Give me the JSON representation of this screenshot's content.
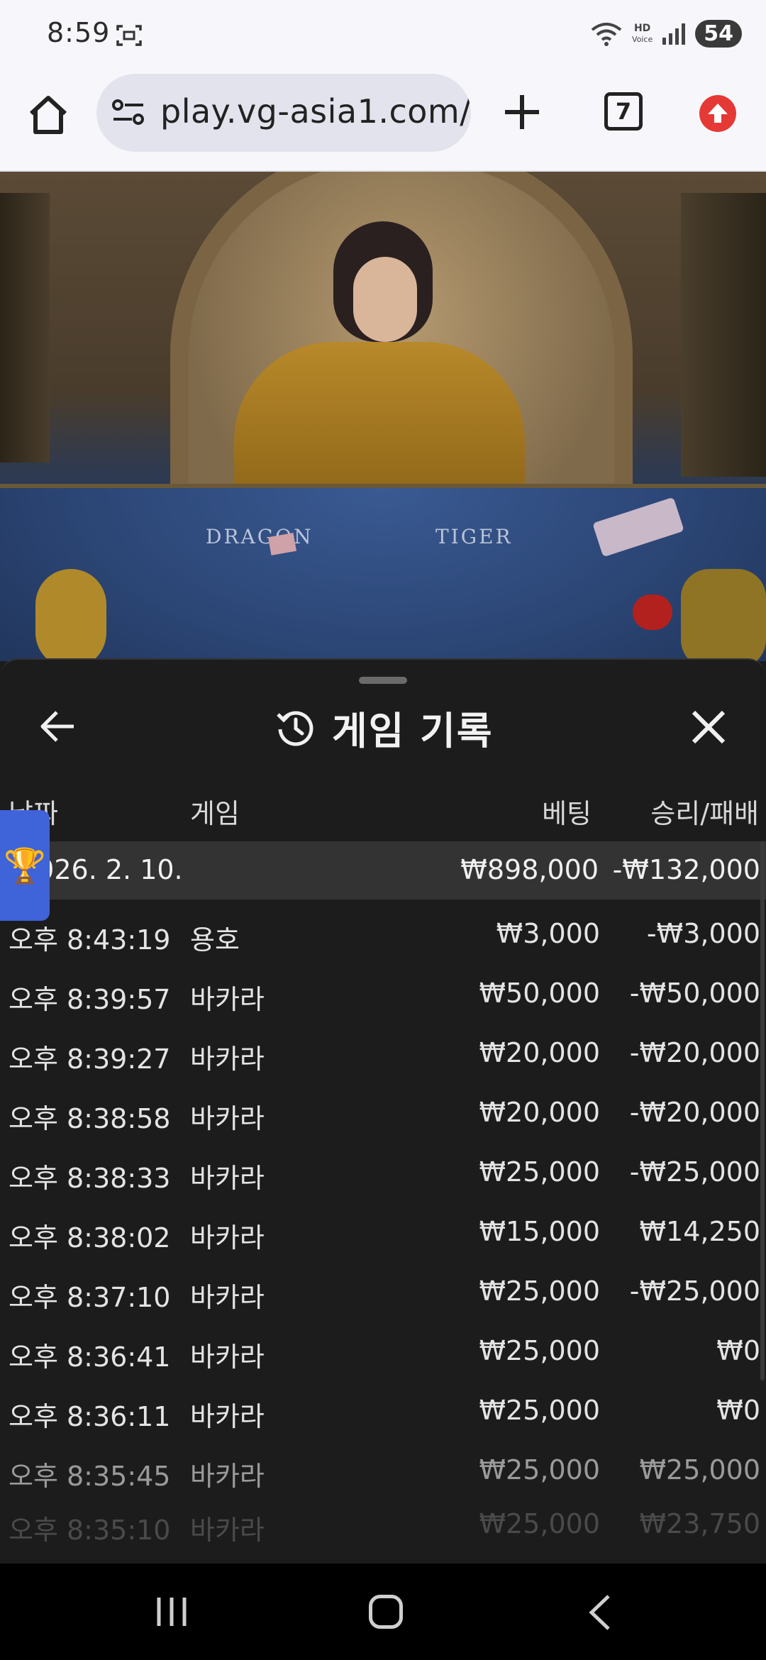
{
  "status": {
    "time": "8:59",
    "hd_line1": "HD",
    "hd_line2": "Voice",
    "battery": "54"
  },
  "browser": {
    "url": "play.vg-asia1.com/",
    "tab_count": "7"
  },
  "video": {
    "label_left": "DRAGON",
    "label_right": "TIGER"
  },
  "panel": {
    "title": "게임 기록",
    "headers": {
      "date": "날짜",
      "game": "게임",
      "bet": "베팅",
      "result": "승리/패배"
    },
    "summary": {
      "date": "2026. 2. 10.",
      "bet": "₩898,000",
      "result": "-₩132,000"
    },
    "rows": [
      {
        "time": "오후 8:43:19",
        "game": "용호",
        "bet": "₩3,000",
        "result": "-₩3,000"
      },
      {
        "time": "오후 8:39:57",
        "game": "바카라",
        "bet": "₩50,000",
        "result": "-₩50,000"
      },
      {
        "time": "오후 8:39:27",
        "game": "바카라",
        "bet": "₩20,000",
        "result": "-₩20,000"
      },
      {
        "time": "오후 8:38:58",
        "game": "바카라",
        "bet": "₩20,000",
        "result": "-₩20,000"
      },
      {
        "time": "오후 8:38:33",
        "game": "바카라",
        "bet": "₩25,000",
        "result": "-₩25,000"
      },
      {
        "time": "오후 8:38:02",
        "game": "바카라",
        "bet": "₩15,000",
        "result": "₩14,250"
      },
      {
        "time": "오후 8:37:10",
        "game": "바카라",
        "bet": "₩25,000",
        "result": "-₩25,000"
      },
      {
        "time": "오후 8:36:41",
        "game": "바카라",
        "bet": "₩25,000",
        "result": "₩0"
      },
      {
        "time": "오후 8:36:11",
        "game": "바카라",
        "bet": "₩25,000",
        "result": "₩0"
      },
      {
        "time": "오후 8:35:45",
        "game": "바카라",
        "bet": "₩25,000",
        "result": "₩25,000"
      },
      {
        "time": "오후 8:35:10",
        "game": "바카라",
        "bet": "₩25,000",
        "result": "₩23,750"
      }
    ]
  }
}
